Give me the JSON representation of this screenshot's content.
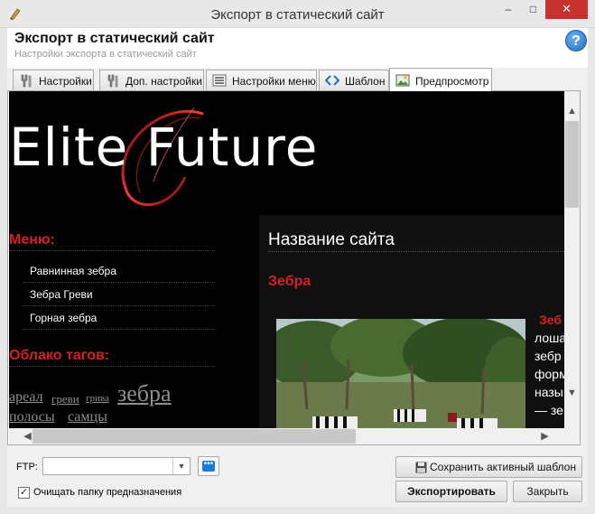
{
  "window": {
    "title": "Экспорт в статический сайт",
    "minimize": "–",
    "maximize": "□",
    "close": "✕"
  },
  "header": {
    "title": "Экспорт в статический сайт",
    "subtitle": "Настройки экспорта в статический сайт",
    "help": "?"
  },
  "tabs": [
    {
      "label": "Настройки",
      "icon": "wrench-icon",
      "active": false
    },
    {
      "label": "Доп. настройки",
      "icon": "wrench-icon",
      "active": false
    },
    {
      "label": "Настройки меню",
      "icon": "menu-list-icon",
      "active": false
    },
    {
      "label": "Шаблон",
      "icon": "code-tags-icon",
      "active": false
    },
    {
      "label": "Предпросмотр",
      "icon": "image-preview-icon",
      "active": true
    }
  ],
  "preview": {
    "logo": "Elite Future",
    "menu_heading": "Меню:",
    "menu_items": [
      "Равнинная зебра",
      "Зебра Греви",
      "Горная зебра"
    ],
    "tags_heading": "Облако тагов:",
    "tags": {
      "t1": "ареал",
      "t2": "греви",
      "t3": "грива",
      "t4": "зебра",
      "t5": "полосы",
      "t6": "самцы"
    },
    "site_name": "Название сайта",
    "article_title": "Зебра",
    "side_text": [
      "Зеб",
      "лоша",
      "зебр",
      "форм",
      "назы",
      "— зе"
    ],
    "accent_color": "#d42020"
  },
  "bottom": {
    "ftp_label": "FTP:",
    "ftp_value": "",
    "ftp_button": "•••",
    "save_template": "Сохранить активный шаблон",
    "export": "Экспортировать",
    "close": "Закрыть",
    "clear_folder": "Очищать папку предназначения",
    "clear_folder_checked": true
  }
}
